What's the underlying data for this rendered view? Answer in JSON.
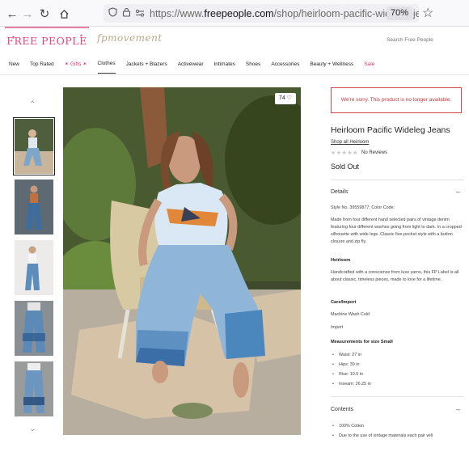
{
  "browser": {
    "url_prefix": "https://www.",
    "url_domain": "freepeople.com",
    "url_path": "/shop/heirloom-pacific-wideleg-je",
    "zoom": "70%"
  },
  "site": {
    "logo": "FREE PEOPLE",
    "movement_logo": "fpmovement",
    "search_placeholder": "Search Free People"
  },
  "nav": {
    "items": [
      "New",
      "Top Rated",
      "✶ Gifts ✶",
      "Clothes",
      "Jackets + Blazers",
      "Activewear",
      "Intimates",
      "Shoes",
      "Accessories",
      "Beauty + Wellness",
      "Sale"
    ]
  },
  "gallery": {
    "likes": "74"
  },
  "product": {
    "error": "We're sorry. This product is no longer available.",
    "title": "Heirloom Pacific Wideleg Jeans",
    "shop_all": "Shop all Heirloom",
    "stars": "★★★★★",
    "reviews": "No Reviews",
    "availability": "Sold Out",
    "details_heading": "Details",
    "style_no": "Style No. 39559877; Color Code:",
    "description": "Made from four different hand selected pairs of vintage denim featuring four different washes going from light to dark. In a cropped silhouette with wide legs. Classic five-pocket style with a button closure and zip fly.",
    "heirloom_heading": "Heirloom",
    "heirloom_text": "Handcrafted with a conscience from luxe yarns, this FP Label is all about classic, timeless pieces, made to love for a lifetime.",
    "care_heading": "Care/Import",
    "care_text": "Machine Wash Cold",
    "import_text": "Import",
    "measure_heading": "Measurements for size Small",
    "measurements": [
      "Waist: 27 in",
      "Hips: 39 in",
      "Rise: 10.5 in",
      "Inseam: 26.25 in"
    ],
    "contents_heading": "Contents",
    "contents": [
      "100% Cotton",
      "Due to the use of vintage materials each pair will"
    ]
  },
  "colors": {
    "brand_pink": "#e0447c",
    "error_red": "#c4373b",
    "sale_red": "#d23c6a"
  }
}
